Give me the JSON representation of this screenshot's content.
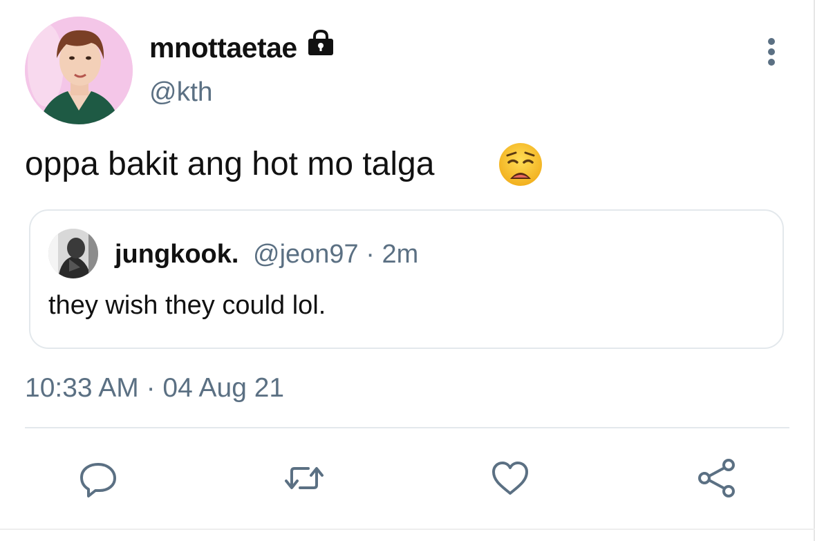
{
  "author": {
    "display_name": "mnottaetae",
    "handle": "@kth",
    "protected": true
  },
  "tweet": {
    "text": "oppa bakit ang hot mo talga",
    "emoji": "weary-face"
  },
  "quoted_tweet": {
    "name": "jungkook.",
    "handle_time": "@jeon97 · 2m",
    "text": "they wish they could lol."
  },
  "timestamp": "10:33 AM · 04 Aug 21",
  "actions": [
    "reply-icon",
    "retweet-icon",
    "like-icon",
    "share-icon"
  ],
  "colors": {
    "secondary_text": "#5b7083",
    "border": "#e3e8ec",
    "icon": "#5b7083"
  }
}
